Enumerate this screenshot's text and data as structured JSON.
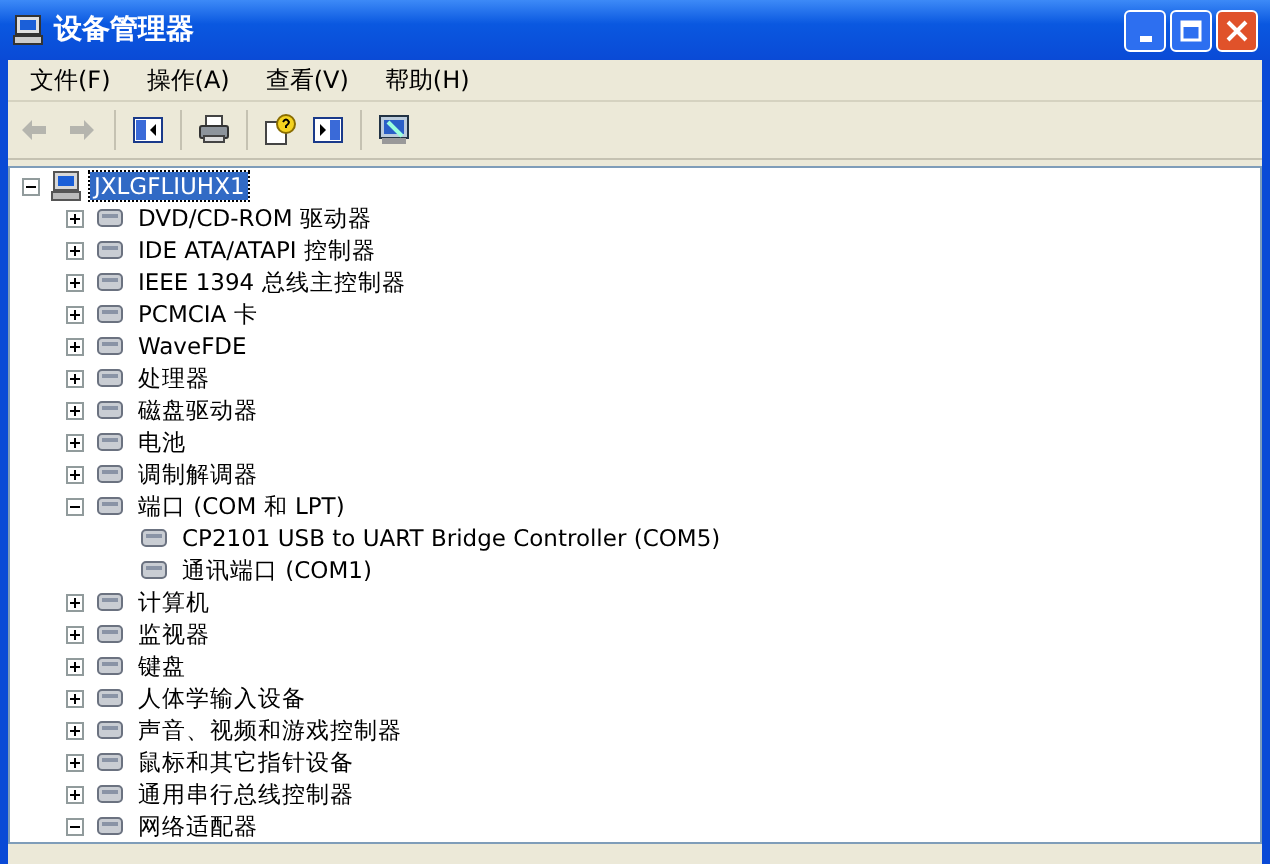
{
  "window": {
    "title": "设备管理器"
  },
  "menu": [
    "文件(F)",
    "操作(A)",
    "查看(V)",
    "帮助(H)"
  ],
  "toolbar": [
    {
      "kind": "back",
      "disabled": true
    },
    {
      "kind": "forward",
      "disabled": true
    },
    {
      "kind": "sep"
    },
    {
      "kind": "tree"
    },
    {
      "kind": "sep"
    },
    {
      "kind": "print"
    },
    {
      "kind": "sep"
    },
    {
      "kind": "help"
    },
    {
      "kind": "panel"
    },
    {
      "kind": "sep"
    },
    {
      "kind": "scan"
    }
  ],
  "tree": {
    "label": "JXLGFLIUHX1",
    "selected": true,
    "expanded": true,
    "children": [
      {
        "label": "DVD/CD-ROM 驱动器",
        "expanded": false
      },
      {
        "label": "IDE ATA/ATAPI 控制器",
        "expanded": false
      },
      {
        "label": "IEEE 1394 总线主控制器",
        "expanded": false
      },
      {
        "label": "PCMCIA 卡",
        "expanded": false
      },
      {
        "label": "WaveFDE",
        "expanded": false
      },
      {
        "label": "处理器",
        "expanded": false
      },
      {
        "label": "磁盘驱动器",
        "expanded": false
      },
      {
        "label": "电池",
        "expanded": false
      },
      {
        "label": "调制解调器",
        "expanded": false
      },
      {
        "label": "端口 (COM 和 LPT)",
        "expanded": true,
        "children": [
          {
            "label": "CP2101 USB to UART Bridge Controller (COM5)"
          },
          {
            "label": "通讯端口 (COM1)"
          }
        ]
      },
      {
        "label": "计算机",
        "expanded": false
      },
      {
        "label": "监视器",
        "expanded": false
      },
      {
        "label": "键盘",
        "expanded": false
      },
      {
        "label": "人体学输入设备",
        "expanded": false
      },
      {
        "label": "声音、视频和游戏控制器",
        "expanded": false
      },
      {
        "label": "鼠标和其它指针设备",
        "expanded": false
      },
      {
        "label": "通用串行总线控制器",
        "expanded": false
      },
      {
        "label": "网络适配器",
        "expanded": true
      }
    ]
  }
}
